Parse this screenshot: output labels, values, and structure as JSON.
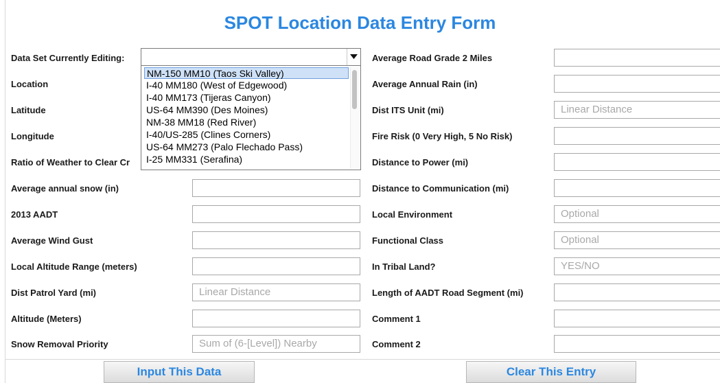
{
  "form": {
    "title": "SPOT Location Data Entry Form"
  },
  "left_rows": [
    {
      "label": "Data Set Currently Editing:"
    },
    {
      "label": "Location"
    },
    {
      "label": "Latitude"
    },
    {
      "label": "Longitude"
    },
    {
      "label": "Ratio of Weather to Clear Cr"
    },
    {
      "label": "Average annual snow (in)",
      "value": "",
      "placeholder": ""
    },
    {
      "label": "2013 AADT",
      "value": "",
      "placeholder": ""
    },
    {
      "label": "Average Wind Gust",
      "value": "",
      "placeholder": ""
    },
    {
      "label": "Local Altitude Range (meters)",
      "value": "",
      "placeholder": ""
    },
    {
      "label": "Dist Patrol Yard (mi)",
      "value": "",
      "placeholder": "Linear Distance"
    },
    {
      "label": "Altitude (Meters)",
      "value": "",
      "placeholder": ""
    },
    {
      "label": "Snow Removal Priority",
      "value": "",
      "placeholder": "Sum of (6-[Level]) Nearby"
    }
  ],
  "right_rows": [
    {
      "label": "Average Road Grade 2 Miles",
      "value": "",
      "placeholder": ""
    },
    {
      "label": "Average Annual Rain (in)",
      "value": "",
      "placeholder": ""
    },
    {
      "label": "Dist ITS Unit (mi)",
      "value": "",
      "placeholder": "Linear Distance"
    },
    {
      "label": "Fire Risk (0 Very High, 5 No Risk)",
      "value": "",
      "placeholder": ""
    },
    {
      "label": "Distance to Power (mi)",
      "value": "",
      "placeholder": ""
    },
    {
      "label": "Distance to Communication (mi)",
      "value": "",
      "placeholder": ""
    },
    {
      "label": "Local Environment",
      "value": "",
      "placeholder": "Optional"
    },
    {
      "label": "Functional Class",
      "value": "",
      "placeholder": "Optional"
    },
    {
      "label": "In Tribal Land?",
      "value": "",
      "placeholder": "YES/NO"
    },
    {
      "label": "Length of AADT Road Segment (mi)",
      "value": "",
      "placeholder": ""
    },
    {
      "label": "Comment 1",
      "value": "",
      "placeholder": ""
    },
    {
      "label": "Comment 2",
      "value": "",
      "placeholder": ""
    }
  ],
  "dataset_select": {
    "value": "",
    "options": [
      "NM-150 MM10 (Taos Ski Valley)",
      "I-40 MM180 (West of Edgewood)",
      "I-40 MM173 (Tijeras Canyon)",
      "US-64 MM390 (Des Moines)",
      "NM-38 MM18 (Red River)",
      "I-40/US-285 (Clines Corners)",
      "US-64 MM273 (Palo Flechado Pass)",
      "I-25 MM331 (Serafina)"
    ],
    "highlighted_index": 0
  },
  "buttons": {
    "input": "Input This Data",
    "clear": "Clear This Entry"
  },
  "colors": {
    "accent": "#2b87e0",
    "field_border": "#a8a8a8",
    "highlight": "#cfe1f7"
  }
}
